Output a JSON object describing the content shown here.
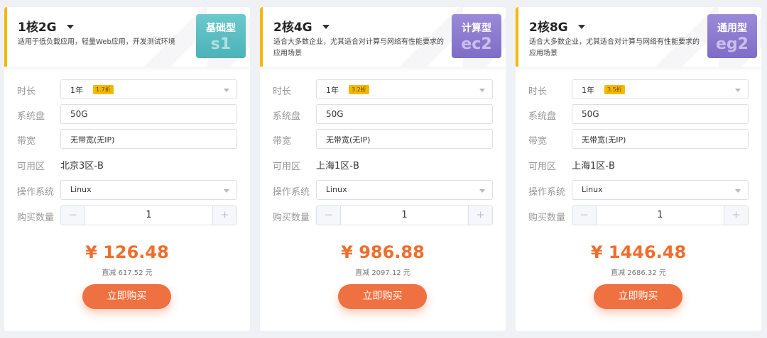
{
  "labels": {
    "duration": "时长",
    "disk": "系统盘",
    "bandwidth": "带宽",
    "zone": "可用区",
    "os": "操作系统",
    "quantity": "购买数量"
  },
  "cards": [
    {
      "spec": "1核2G",
      "description": "适用于低负载应用，轻量Web应用，开发测试环境",
      "type_name": "基础型",
      "type_code": "s1",
      "badge_color": "#55b9bd",
      "duration": "1年",
      "discount": "1.7折",
      "disk": "50G",
      "bandwidth": "无带宽(无IP)",
      "zone": "北京3区-B",
      "os": "Linux",
      "quantity": "1",
      "price": "¥ 126.48",
      "saving": "直减 617.52 元",
      "buy_label": "立即购买"
    },
    {
      "spec": "2核4G",
      "description": "适合大多数企业，尤其适合对计算与网络有性能要求的应用场景",
      "type_name": "计算型",
      "type_code": "ec2",
      "badge_color": "#8a79cf",
      "duration": "1年",
      "discount": "3.2折",
      "disk": "50G",
      "bandwidth": "无带宽(无IP)",
      "zone": "上海1区-B",
      "os": "Linux",
      "quantity": "1",
      "price": "¥ 986.88",
      "saving": "直减 2097.12 元",
      "buy_label": "立即购买"
    },
    {
      "spec": "2核8G",
      "description": "适合大多数企业，尤其适合对计算与网络有性能要求的应用场景",
      "type_name": "通用型",
      "type_code": "eg2",
      "badge_color": "#8a79cf",
      "duration": "1年",
      "discount": "3.5折",
      "disk": "50G",
      "bandwidth": "无带宽(无IP)",
      "zone": "上海1区-B",
      "os": "Linux",
      "quantity": "1",
      "price": "¥ 1446.48",
      "saving": "直减 2686.32 元",
      "buy_label": "立即购买"
    }
  ],
  "stepper": {
    "minus": "−",
    "plus": "+"
  },
  "colors": {
    "accent_bar": "#f5b800",
    "price": "#f06d2d",
    "buy_button": "#ef7040",
    "discount_tag": "#f5b800"
  }
}
